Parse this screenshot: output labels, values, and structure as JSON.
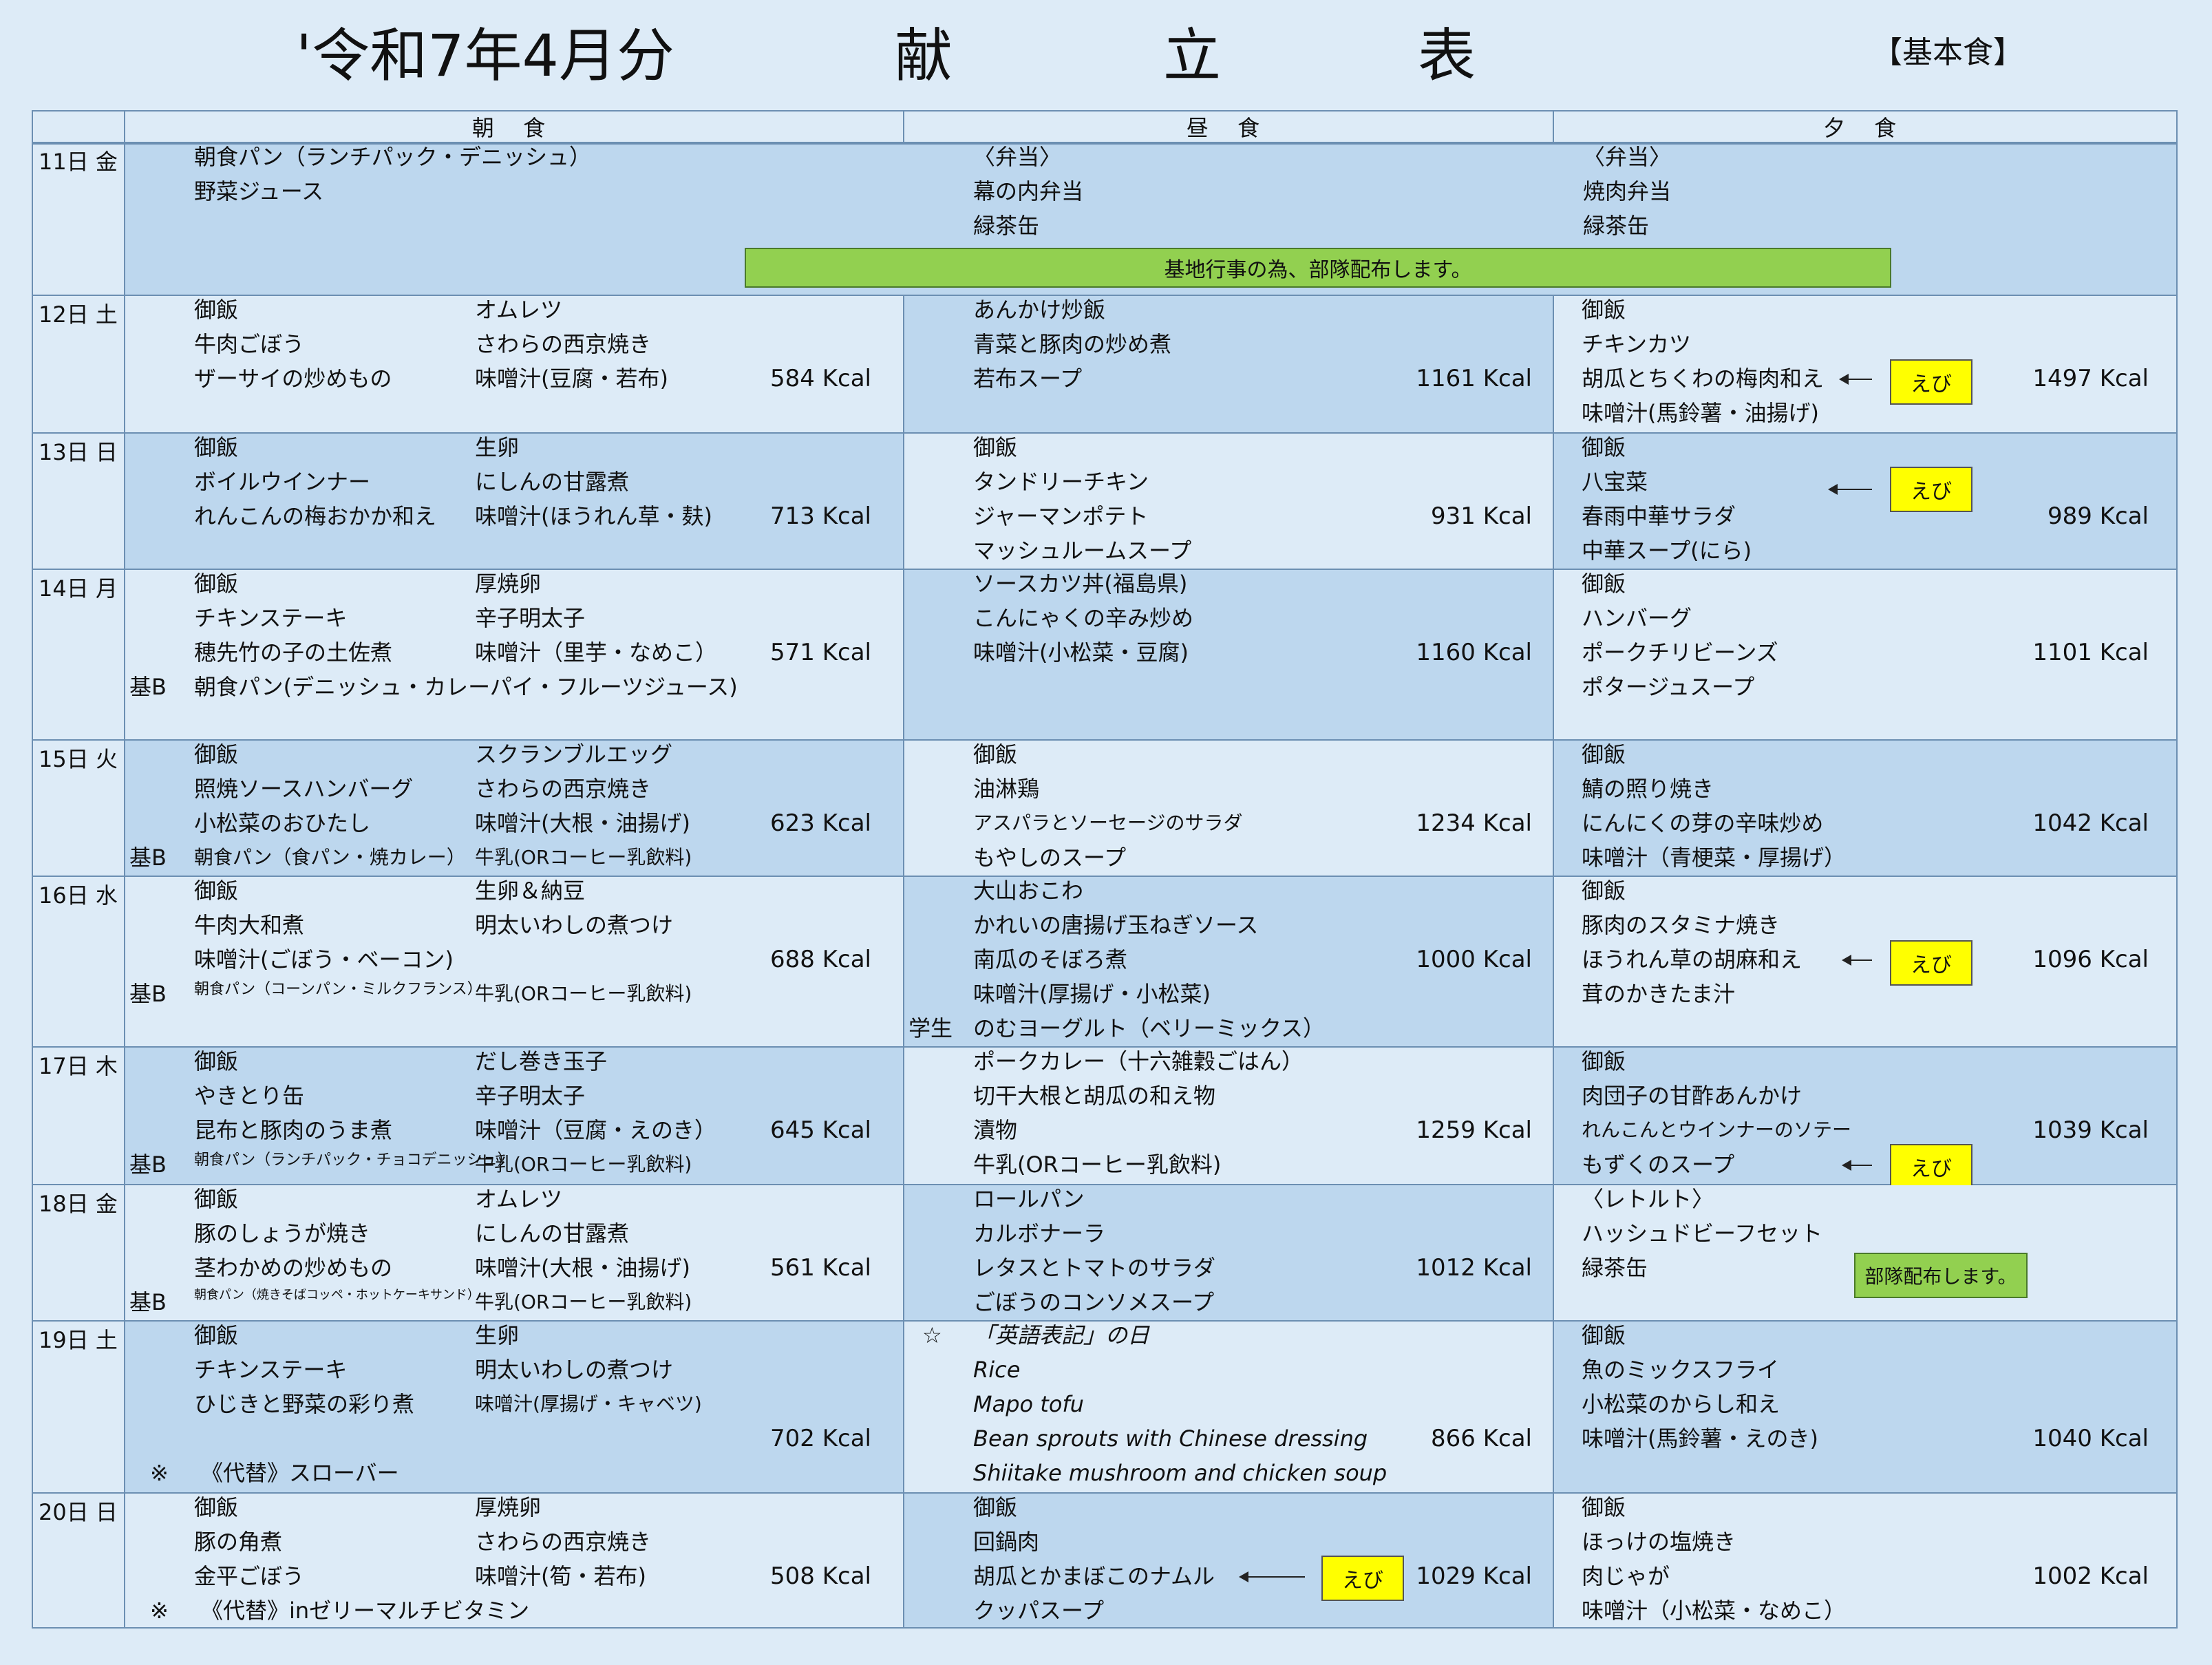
{
  "header": {
    "month": "'令和7年4月分",
    "title_1": "献",
    "title_2": "立",
    "title_3": "表",
    "menu_type": "【基本食】"
  },
  "columns": {
    "breakfast": "朝 食",
    "lunch": "昼 食",
    "dinner": "夕 食"
  },
  "days": [
    {
      "date": "11日 金",
      "breakfast": [
        "朝食パン（ランチパック・デニッシュ）",
        "野菜ジュース"
      ],
      "lunch": [
        "〈弁当〉",
        "幕の内弁当",
        "緑茶缶"
      ],
      "dinner": [
        "〈弁当〉",
        "焼肉弁当",
        "緑茶缶"
      ],
      "banner": "基地行事の為、部隊配布します。"
    },
    {
      "date": "12日 土",
      "breakfast_a": [
        "御飯",
        "牛肉ごぼう",
        "ザーサイの炒めもの"
      ],
      "breakfast_b": [
        "オムレツ",
        "さわらの西京焼き",
        "味噌汁(豆腐・若布)"
      ],
      "breakfast_kcal": "584 Kcal",
      "lunch": [
        "あんかけ炒飯",
        "青菜と豚肉の炒め煮",
        "若布スープ"
      ],
      "lunch_kcal": "1161 Kcal",
      "dinner": [
        "御飯",
        "チキンカツ",
        "胡瓜とちくわの梅肉和え",
        "味噌汁(馬鈴薯・油揚げ)"
      ],
      "dinner_kcal": "1497 Kcal",
      "dinner_note": "えび"
    },
    {
      "date": "13日 日",
      "breakfast_a": [
        "御飯",
        "ボイルウインナー",
        "れんこんの梅おかか和え"
      ],
      "breakfast_b": [
        "生卵",
        "にしんの甘露煮",
        "味噌汁(ほうれん草・麸)"
      ],
      "breakfast_kcal": "713 Kcal",
      "lunch": [
        "御飯",
        "タンドリーチキン",
        "ジャーマンポテト",
        "マッシュルームスープ"
      ],
      "lunch_kcal": "931 Kcal",
      "dinner": [
        "御飯",
        "八宝菜",
        "春雨中華サラダ",
        "中華スープ(にら)"
      ],
      "dinner_kcal": "989 Kcal",
      "dinner_note": "えび"
    },
    {
      "date": "14日 月",
      "breakfast_a": [
        "御飯",
        "チキンステーキ",
        "穂先竹の子の土佐煮"
      ],
      "breakfast_b": [
        "厚焼卵",
        "辛子明太子",
        "味噌汁（里芋・なめこ）"
      ],
      "breakfast_kcal": "571 Kcal",
      "kib_label": "基B",
      "kib": "朝食パン(デニッシュ・カレーパイ・フルーツジュース)",
      "lunch": [
        "ソースカツ丼(福島県)",
        "こんにゃくの辛み炒め",
        "味噌汁(小松菜・豆腐)"
      ],
      "lunch_kcal": "1160 Kcal",
      "dinner": [
        "御飯",
        "ハンバーグ",
        "ポークチリビーンズ",
        "ポタージュスープ"
      ],
      "dinner_kcal": "1101 Kcal"
    },
    {
      "date": "15日 火",
      "breakfast_a": [
        "御飯",
        "照焼ソースハンバーグ",
        "小松菜のおひたし"
      ],
      "breakfast_b": [
        "スクランブルエッグ",
        "さわらの西京焼き",
        "味噌汁(大根・油揚げ)"
      ],
      "breakfast_kcal": "623 Kcal",
      "kib_label": "基B",
      "kib": "朝食パン（食パン・焼カレー）",
      "kib_b": "牛乳(ORコーヒー乳飲料)",
      "lunch": [
        "御飯",
        "油淋鶏",
        "アスパラとソーセージのサラダ",
        "もやしのスープ"
      ],
      "lunch_kcal": "1234 Kcal",
      "dinner": [
        "御飯",
        "鯖の照り焼き",
        "にんにくの芽の辛味炒め",
        "味噌汁（青梗菜・厚揚げ）"
      ],
      "dinner_kcal": "1042 Kcal"
    },
    {
      "date": "16日 水",
      "breakfast_a": [
        "御飯",
        "牛肉大和煮",
        "味噌汁(ごぼう・ベーコン)"
      ],
      "breakfast_b": [
        "生卵＆納豆",
        "明太いわしの煮つけ"
      ],
      "breakfast_kcal": "688 Kcal",
      "kib_label": "基B",
      "kib": "朝食パン（コーンパン・ミルクフランス）",
      "kib_b": "牛乳(ORコーヒー乳飲料)",
      "lunch": [
        "大山おこわ",
        "かれいの唐揚げ玉ねぎソース",
        "南瓜のそぼろ煮",
        "味噌汁(厚揚げ・小松菜)"
      ],
      "lunch_kcal": "1000 Kcal",
      "student_label": "学生",
      "student": "のむヨーグルト（ベリーミックス）",
      "dinner": [
        "御飯",
        "豚肉のスタミナ焼き",
        "ほうれん草の胡麻和え",
        "茸のかきたま汁"
      ],
      "dinner_kcal": "1096 Kcal",
      "dinner_note": "えび"
    },
    {
      "date": "17日 木",
      "breakfast_a": [
        "御飯",
        "やきとり缶",
        "昆布と豚肉のうま煮"
      ],
      "breakfast_b": [
        "だし巻き玉子",
        "辛子明太子",
        "味噌汁（豆腐・えのき）"
      ],
      "breakfast_kcal": "645 Kcal",
      "kib_label": "基B",
      "kib": "朝食パン（ランチパック・チョコデニッシュ）",
      "kib_b": "牛乳(ORコーヒー乳飲料)",
      "lunch": [
        "ポークカレー（十六雑穀ごはん）",
        "切干大根と胡瓜の和え物",
        "漬物",
        "牛乳(ORコーヒー乳飲料)"
      ],
      "lunch_kcal": "1259 Kcal",
      "dinner": [
        "御飯",
        "肉団子の甘酢あんかけ",
        "れんこんとウインナーのソテー",
        "もずくのスープ"
      ],
      "dinner_kcal": "1039 Kcal",
      "dinner_note": "えび"
    },
    {
      "date": "18日 金",
      "breakfast_a": [
        "御飯",
        "豚のしょうが焼き",
        "茎わかめの炒めもの"
      ],
      "breakfast_b": [
        "オムレツ",
        "にしんの甘露煮",
        "味噌汁(大根・油揚げ)"
      ],
      "breakfast_kcal": "561 Kcal",
      "kib_label": "基B",
      "kib": "朝食パン（焼きそばコッペ・ホットケーキサンド）",
      "kib_b": "牛乳(ORコーヒー乳飲料)",
      "lunch": [
        "ロールパン",
        "カルボナーラ",
        "レタスとトマトのサラダ",
        "ごぼうのコンソメスープ"
      ],
      "lunch_kcal": "1012 Kcal",
      "dinner": [
        "〈レトルト〉",
        "ハッシュドビーフセット",
        "緑茶缶"
      ],
      "dinner_banner": "部隊配布します。"
    },
    {
      "date": "19日 土",
      "breakfast_a": [
        "御飯",
        "チキンステーキ",
        "ひじきと野菜の彩り煮"
      ],
      "breakfast_b": [
        "生卵",
        "明太いわしの煮つけ",
        "味噌汁(厚揚げ・キャベツ)"
      ],
      "breakfast_kcal": "702 Kcal",
      "alt_mark": "※",
      "alt": "《代替》スローバー",
      "lunch_star": "☆",
      "lunch": [
        "「英語表記」の日",
        "Rice",
        "Mapo tofu",
        "Bean sprouts with Chinese dressing",
        "Shiitake mushroom and chicken soup"
      ],
      "lunch_kcal": "866 Kcal",
      "dinner": [
        "御飯",
        "魚のミックスフライ",
        "小松菜のからし和え",
        "味噌汁(馬鈴薯・えのき)"
      ],
      "dinner_kcal": "1040 Kcal"
    },
    {
      "date": "20日 日",
      "breakfast_a": [
        "御飯",
        "豚の角煮",
        "金平ごぼう"
      ],
      "breakfast_b": [
        "厚焼卵",
        "さわらの西京焼き",
        "味噌汁(筍・若布)"
      ],
      "breakfast_kcal": "508 Kcal",
      "alt_mark": "※",
      "alt": "《代替》inゼリーマルチビタミン",
      "lunch": [
        "御飯",
        "回鍋肉",
        "胡瓜とかまぼこのナムル",
        "クッパスープ"
      ],
      "lunch_kcal": "1029 Kcal",
      "lunch_note": "えび",
      "dinner": [
        "御飯",
        "ほっけの塩焼き",
        "肉じゃが",
        "味噌汁（小松菜・なめこ）"
      ],
      "dinner_kcal": "1002 Kcal"
    }
  ]
}
